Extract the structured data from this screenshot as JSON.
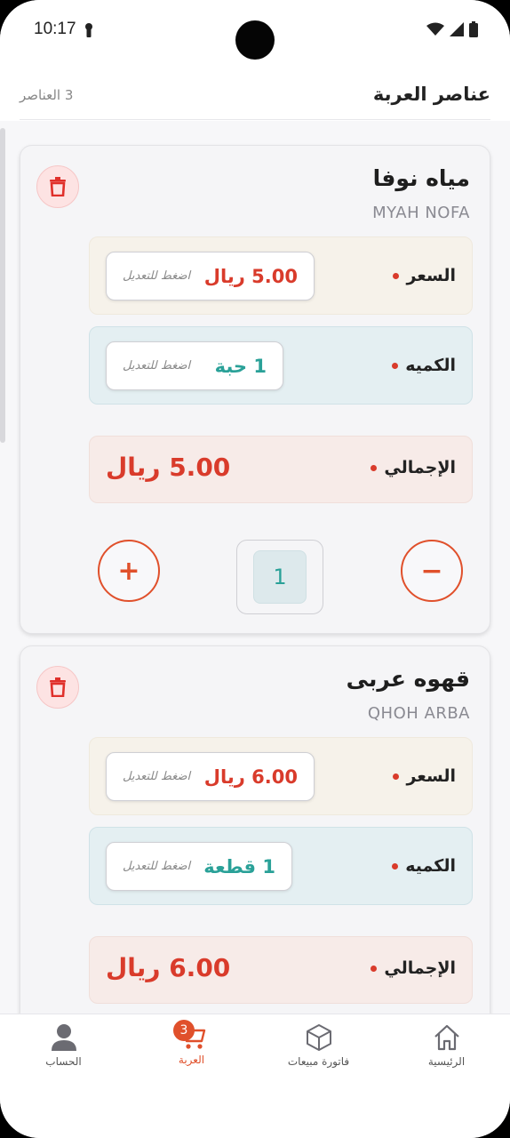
{
  "status_bar": {
    "time": "10:17"
  },
  "header": {
    "title": "عناصر العربة",
    "count": "3 العناصر"
  },
  "cart_items": [
    {
      "name": "مياه نوفا",
      "transliteration": "MYAH NOFA",
      "price_label": "السعر",
      "price_value": "5.00 ريال",
      "qty_label": "الكميه",
      "qty_value": "1 حبة",
      "edit_hint": "اضغط للتعديل",
      "total_label": "الإجمالي",
      "total_value": "5.00 ريال",
      "stepper_value": "1",
      "plus": "+",
      "minus": "−"
    },
    {
      "name": "قهوه عربى",
      "transliteration": "QHOH ARBA",
      "price_label": "السعر",
      "price_value": "6.00 ريال",
      "qty_label": "الكميه",
      "qty_value": "1 قطعة",
      "edit_hint": "اضغط للتعديل",
      "total_label": "الإجمالي",
      "total_value": "6.00 ريال"
    }
  ],
  "bottom_nav": {
    "items": [
      {
        "label": "الحساب",
        "icon": "person-icon"
      },
      {
        "label": "العربة",
        "icon": "cart-icon",
        "badge": "3",
        "active": true
      },
      {
        "label": "فاتورة مبيعات",
        "icon": "box-icon"
      },
      {
        "label": "الرئيسية",
        "icon": "home-icon"
      }
    ]
  },
  "colors": {
    "accent": "#e0502b",
    "price_red": "#d93b2b",
    "qty_teal": "#2aa198"
  }
}
